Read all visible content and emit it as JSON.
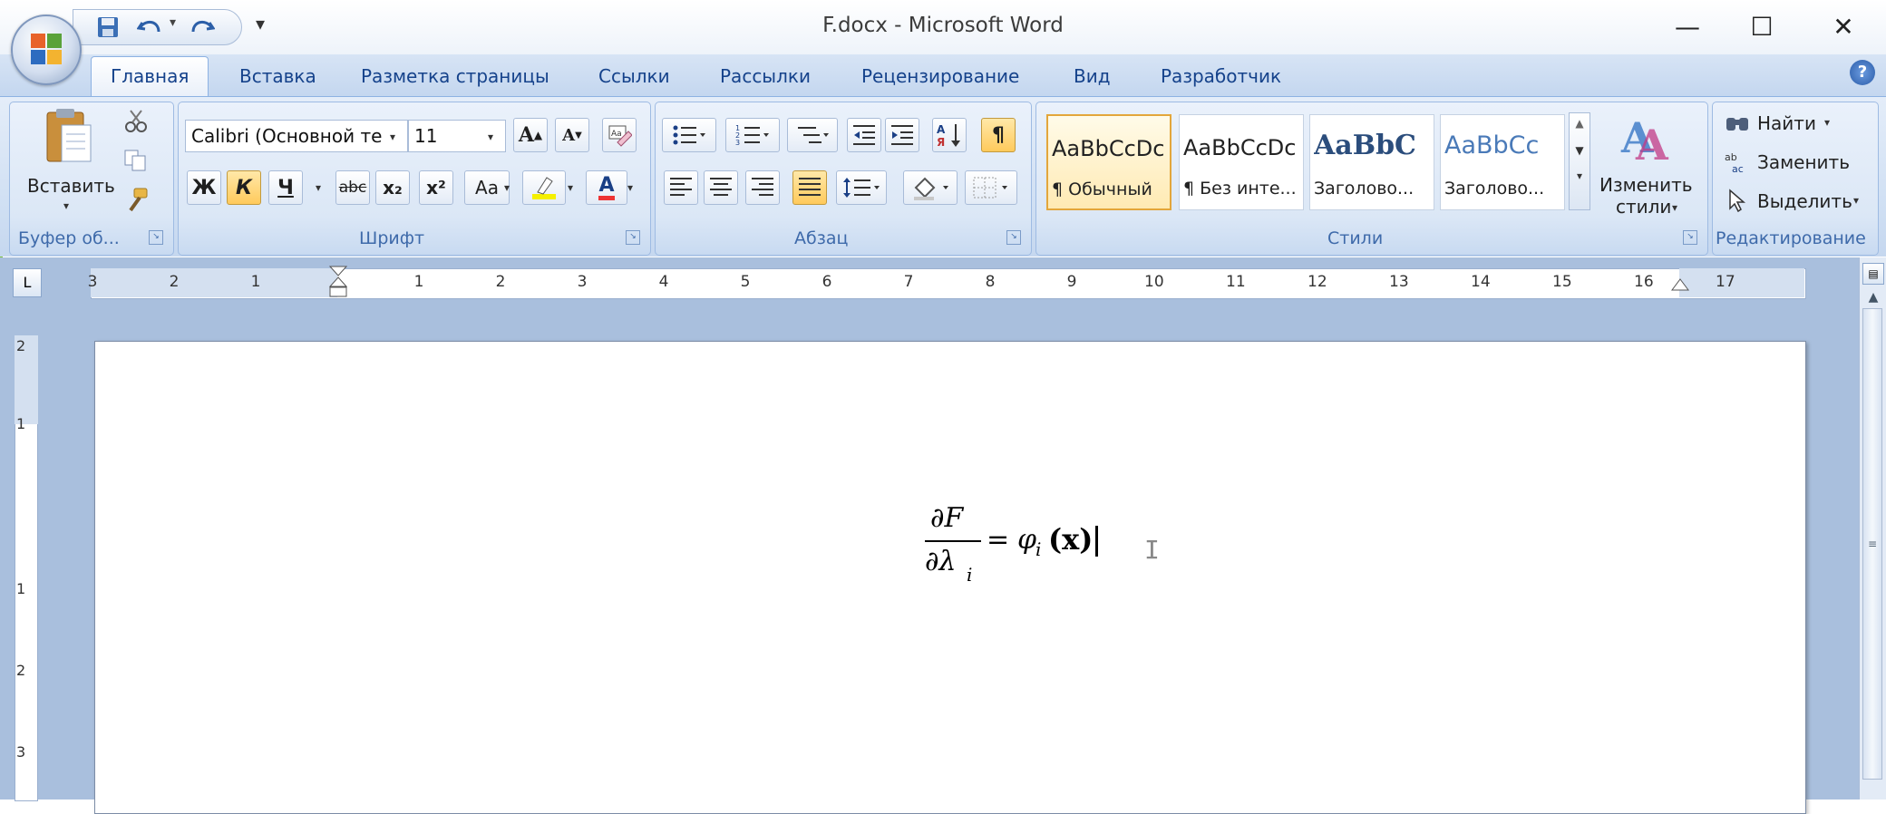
{
  "window": {
    "title": "F.docx - Microsoft Word",
    "minimize": "—",
    "maximize": "☐",
    "close": "✕"
  },
  "qat": {
    "save": "save-icon",
    "undo": "undo-icon",
    "redo": "redo-icon",
    "customize": "▾"
  },
  "tabs": [
    "Главная",
    "Вставка",
    "Разметка страницы",
    "Ссылки",
    "Рассылки",
    "Рецензирование",
    "Вид",
    "Разработчик"
  ],
  "help": "?",
  "clipboard": {
    "paste_label": "Вставить",
    "group_label": "Буфер об..."
  },
  "font": {
    "font_name": "Calibri (Основной те",
    "font_size": "11",
    "grow": "A",
    "shrink": "A",
    "bold": "Ж",
    "italic": "К",
    "underline": "Ч",
    "strike": "abc",
    "subscript": "x₂",
    "superscript": "x²",
    "case": "Aa",
    "color_letter": "A",
    "group_label": "Шрифт"
  },
  "paragraph": {
    "group_label": "Абзац",
    "pilcrow": "¶"
  },
  "styles": {
    "tiles": [
      {
        "sample": "AaBbCcDc",
        "name": "¶ Обычный"
      },
      {
        "sample": "AaBbCcDc",
        "name": "¶ Без инте..."
      },
      {
        "sample": "AaBbC",
        "name": "Заголово..."
      },
      {
        "sample": "AaBbCc",
        "name": "Заголово..."
      }
    ],
    "change_label_1": "Изменить",
    "change_label_2": "стили",
    "group_label": "Стили"
  },
  "editing": {
    "find": "Найти",
    "replace": "Заменить",
    "select": "Выделить",
    "group_label": "Редактирование"
  },
  "ruler": {
    "tab_selector": "L",
    "numbers": [
      "3",
      "2",
      "1",
      "1",
      "2",
      "3",
      "4",
      "5",
      "6",
      "7",
      "8",
      "9",
      "10",
      "11",
      "12",
      "13",
      "14",
      "15",
      "16",
      "17"
    ],
    "vertical_numbers": [
      "2",
      "1",
      "1",
      "2",
      "3"
    ]
  },
  "document": {
    "equation": {
      "numerator": "∂F",
      "denominator": "∂λ",
      "subscript": "i",
      "equals": "=",
      "phi": "φ",
      "phi_sub": "i",
      "argument": "(x)"
    }
  }
}
